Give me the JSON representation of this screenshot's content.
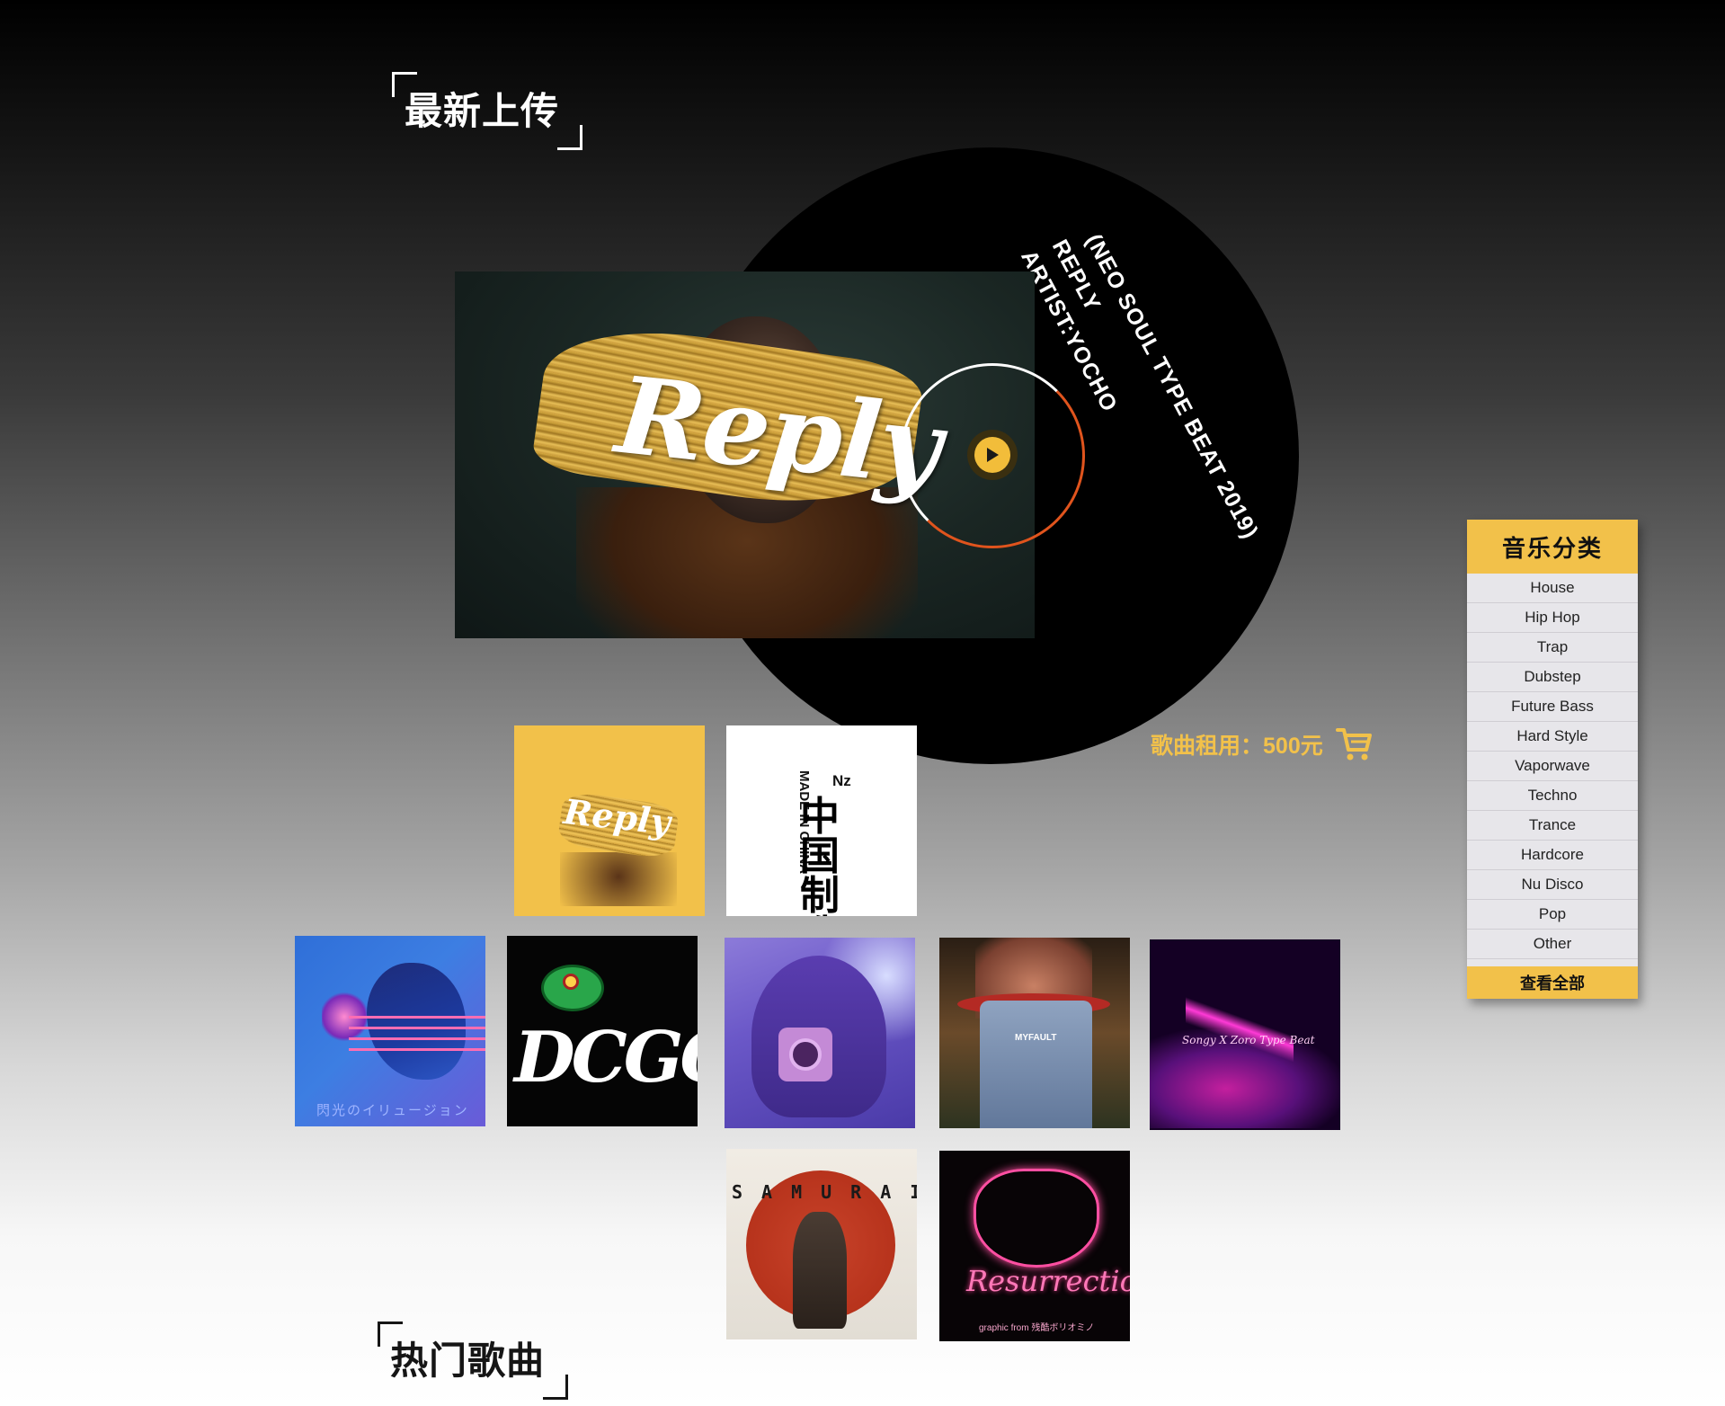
{
  "sections": {
    "latest_title": "最新上传",
    "hot_title": "热门歌曲"
  },
  "featured": {
    "cover_word": "Reply",
    "vinyl_line1": "(NEO SOUL TYPE BEAT 2019)",
    "vinyl_line2": "REPLY",
    "vinyl_line3": "ARTIST:YOCHO",
    "price_label": "歌曲租用：",
    "price_value": "500元",
    "play_icon": "play-icon",
    "cart_icon": "cart-icon"
  },
  "thumbnails": {
    "reply": {
      "word": "Reply"
    },
    "made_in_china": {
      "vertical": "MADE IN CHINA",
      "nz": "Nz",
      "big": "中国制造"
    },
    "flash": {
      "caption": "閃光のイリュージョン"
    },
    "dcgo": {
      "word": "DCGO"
    },
    "overalls": {
      "label": "MYFAULT"
    },
    "zoro": {
      "text": "Songy X Zoro Type Beat"
    },
    "samurai": {
      "title": "SAMURAI"
    },
    "resurrection": {
      "word": "Resurrection",
      "small": "graphic from 残酷ボリオミノ"
    }
  },
  "categories": {
    "title": "音乐分类",
    "items": [
      "House",
      "Hip Hop",
      "Trap",
      "Dubstep",
      "Future Bass",
      "Hard Style",
      "Vaporwave",
      "Techno",
      "Trance",
      "Hardcore",
      "Nu Disco",
      "Pop",
      "Other"
    ],
    "view_all": "查看全部"
  },
  "colors": {
    "accent": "#f2c14a",
    "ring_orange": "#e0541d"
  }
}
